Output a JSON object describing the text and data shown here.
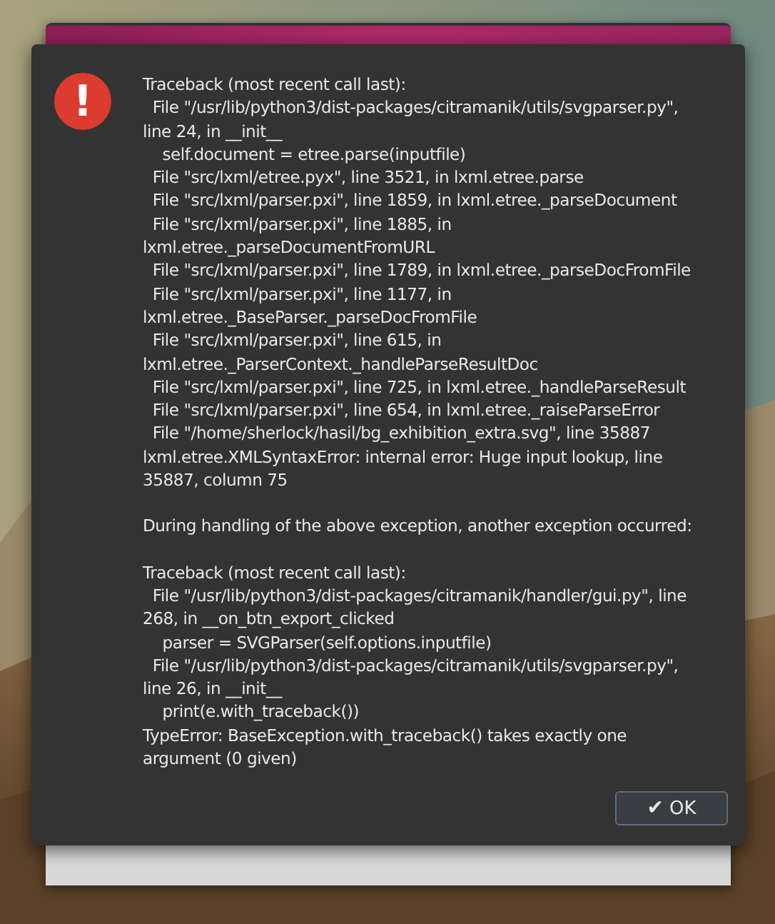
{
  "dialog": {
    "icon": "!",
    "message": [
      [
        "Traceback (most recent call last):",
        "  File \"/usr/lib/python3/dist-packages/citramanik/utils/svgparser.py\",",
        "line 24, in __init__",
        "    self.document = etree.parse(inputfile)",
        "  File \"src/lxml/etree.pyx\", line 3521, in lxml.etree.parse",
        "  File \"src/lxml/parser.pxi\", line 1859, in lxml.etree._parseDocument",
        "  File \"src/lxml/parser.pxi\", line 1885, in",
        "lxml.etree._parseDocumentFromURL",
        "  File \"src/lxml/parser.pxi\", line 1789, in lxml.etree._parseDocFromFile",
        "  File \"src/lxml/parser.pxi\", line 1177, in",
        "lxml.etree._BaseParser._parseDocFromFile",
        "  File \"src/lxml/parser.pxi\", line 615, in",
        "lxml.etree._ParserContext._handleParseResultDoc",
        "  File \"src/lxml/parser.pxi\", line 725, in lxml.etree._handleParseResult",
        "  File \"src/lxml/parser.pxi\", line 654, in lxml.etree._raiseParseError",
        "  File \"/home/sherlock/hasil/bg_exhibition_extra.svg\", line 35887",
        "lxml.etree.XMLSyntaxError: internal error: Huge input lookup, line",
        "35887, column 75"
      ],
      [
        "During handling of the above exception, another exception occurred:"
      ],
      [
        "Traceback (most recent call last):",
        "  File \"/usr/lib/python3/dist-packages/citramanik/handler/gui.py\", line",
        "268, in __on_btn_export_clicked",
        "    parser = SVGParser(self.options.inputfile)",
        "  File \"/usr/lib/python3/dist-packages/citramanik/utils/svgparser.py\",",
        "line 26, in __init__",
        "    print(e.with_traceback())",
        "TypeError: BaseException.with_traceback() takes exactly one",
        "argument (0 given)"
      ]
    ],
    "ok_button": {
      "check": "✔",
      "label": "OK"
    }
  }
}
